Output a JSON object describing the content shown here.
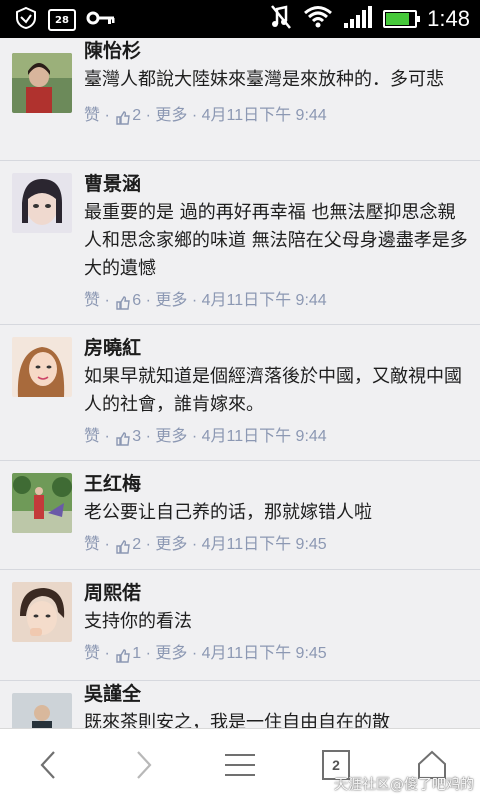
{
  "status_bar": {
    "time": "1:48",
    "chip_label": "28",
    "icons": [
      "shield-icon",
      "key-icon",
      "mute-icon",
      "wifi-icon",
      "signal-icon",
      "battery-icon"
    ],
    "battery_level": 0.75
  },
  "comments": [
    {
      "name": "陳怡杉",
      "text": "臺灣人都說大陸妹來臺灣是來放种的．多可悲",
      "like_label": "赞",
      "likes": "2",
      "more_label": "更多",
      "time": "4月11日下午 9:44",
      "sep": " · "
    },
    {
      "name": "曹景涵",
      "text": "最重要的是 過的再好再幸福 也無法壓抑思念親人和思念家鄉的味道 無法陪在父母身邊盡孝是多大的遺憾",
      "like_label": "赞",
      "likes": "6",
      "more_label": "更多",
      "time": "4月11日下午 9:44",
      "sep": " · "
    },
    {
      "name": "房曉紅",
      "text": "如果早就知道是個經濟落後於中國，又敵視中國人的社會，誰肯嫁來。",
      "like_label": "赞",
      "likes": "3",
      "more_label": "更多",
      "time": "4月11日下午 9:44",
      "sep": " · "
    },
    {
      "name": "王红梅",
      "text": "老公要让自己养的话，那就嫁错人啦",
      "like_label": "赞",
      "likes": "2",
      "more_label": "更多",
      "time": "4月11日下午 9:45",
      "sep": " · "
    },
    {
      "name": "周熙偌",
      "text": "支持你的看法",
      "like_label": "赞",
      "likes": "1",
      "more_label": "更多",
      "time": "4月11日下午 9:45",
      "sep": " · "
    },
    {
      "name": "吳謹全",
      "text": "既來茶則安之，我是一住自由自在的散"
    }
  ],
  "nav": {
    "tab_count": "2",
    "watermark": "天涯社区@傻了吧鸡的"
  },
  "colors": {
    "meta": "#8c98b3",
    "battery": "#46c83a"
  }
}
